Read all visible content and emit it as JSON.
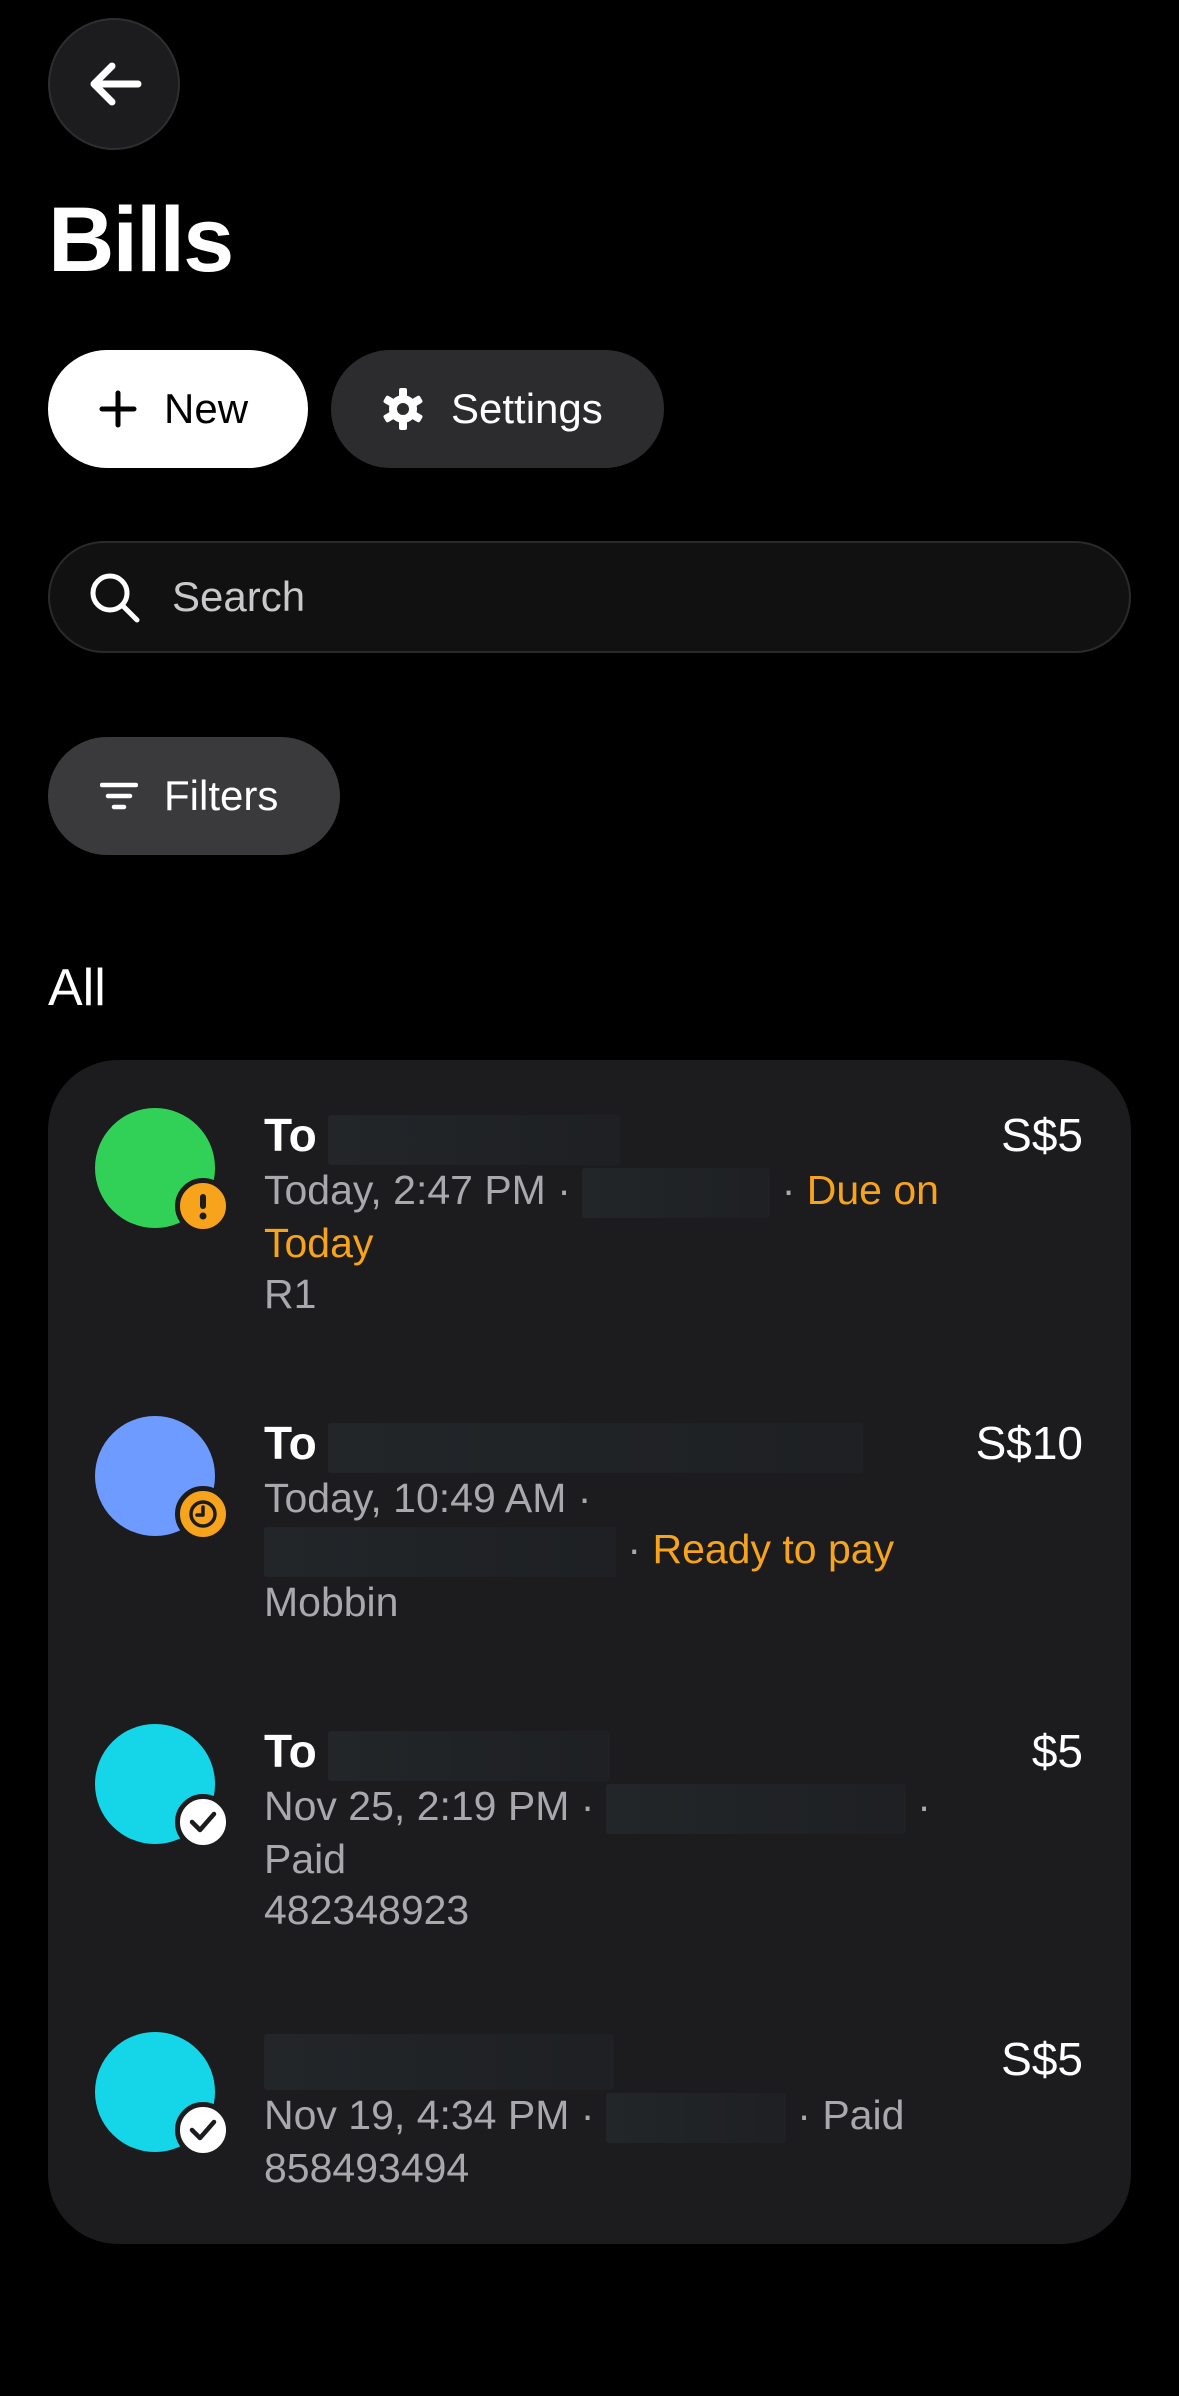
{
  "header": {
    "back_icon": "arrow-left-icon",
    "title": "Bills"
  },
  "actions": {
    "new_label": "New",
    "settings_label": "Settings"
  },
  "search": {
    "placeholder": "Search"
  },
  "filters": {
    "label": "Filters"
  },
  "section": {
    "label": "All"
  },
  "colors": {
    "accent_orange": "#f7a31c",
    "avatar_green": "#31d158",
    "avatar_blue": "#6e9bff",
    "avatar_cyan": "#14d6e8"
  },
  "bills": [
    {
      "prefix": "To",
      "datetime": "Today, 2:47 PM ·",
      "separator": "·",
      "status": "Due on Today",
      "reference": "R1",
      "amount": "S$5",
      "status_icon": "exclamation-icon"
    },
    {
      "prefix": "To",
      "datetime": "Today, 10:49 AM ·",
      "separator": "·",
      "status": "Ready to pay",
      "reference": "Mobbin",
      "amount": "S$10",
      "status_icon": "clock-icon"
    },
    {
      "prefix": "To",
      "datetime": "Nov 25, 2:19 PM ·",
      "separator": "·",
      "status": "Paid",
      "reference": "482348923",
      "amount": "$5",
      "status_icon": "check-icon"
    },
    {
      "prefix": "",
      "datetime": "Nov 19, 4:34 PM ·",
      "separator": "·",
      "status": "Paid",
      "reference": "858493494",
      "amount": "S$5",
      "status_icon": "check-icon"
    }
  ]
}
